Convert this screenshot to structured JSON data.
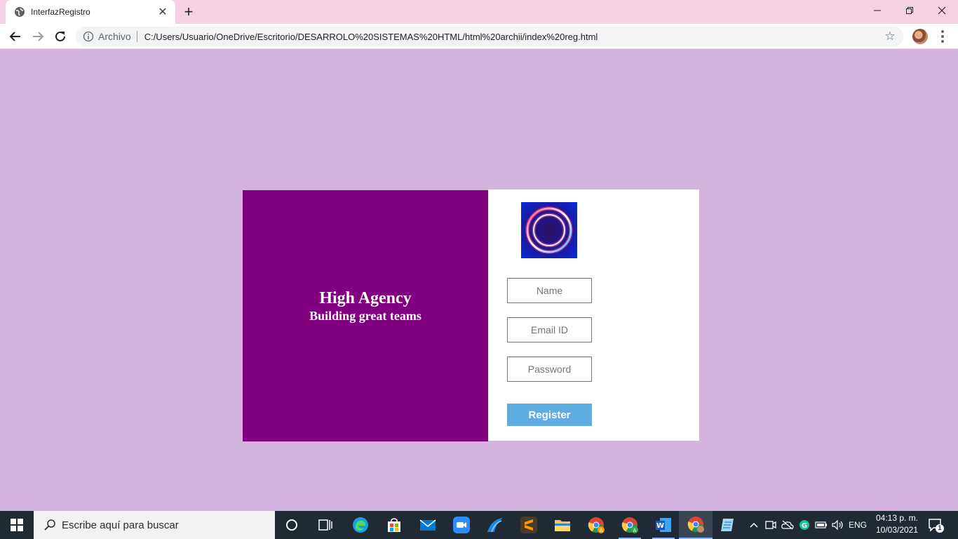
{
  "browser": {
    "tab_title": "InterfazRegistro",
    "scheme_label": "Archivo",
    "url": "C:/Users/Usuario/OneDrive/Escritorio/DESARROLO%20SISTEMAS%20HTML/html%20archii/index%20reg.html"
  },
  "page": {
    "heading": "High Agency",
    "subheading": "Building great teams",
    "name_placeholder": "Name",
    "email_placeholder": "Email ID",
    "password_placeholder": "Password",
    "register_label": "Register"
  },
  "taskbar": {
    "search_placeholder": "Escribe aquí para buscar",
    "language": "ENG",
    "time": "04:13 p. m.",
    "date": "10/03/2021",
    "notification_count": "1",
    "pinned_apps": [
      "task-view",
      "edge",
      "store",
      "mail",
      "zoom",
      "dolphin-browser",
      "sublime-text",
      "file-explorer",
      "chrome-profile-a",
      "chrome-profile-b",
      "word",
      "chrome",
      "notepad"
    ]
  },
  "colors": {
    "page_background": "#d3b4de",
    "left_panel": "#800080",
    "register_button": "#5dade2",
    "tab_strip": "#f5d1e3"
  }
}
